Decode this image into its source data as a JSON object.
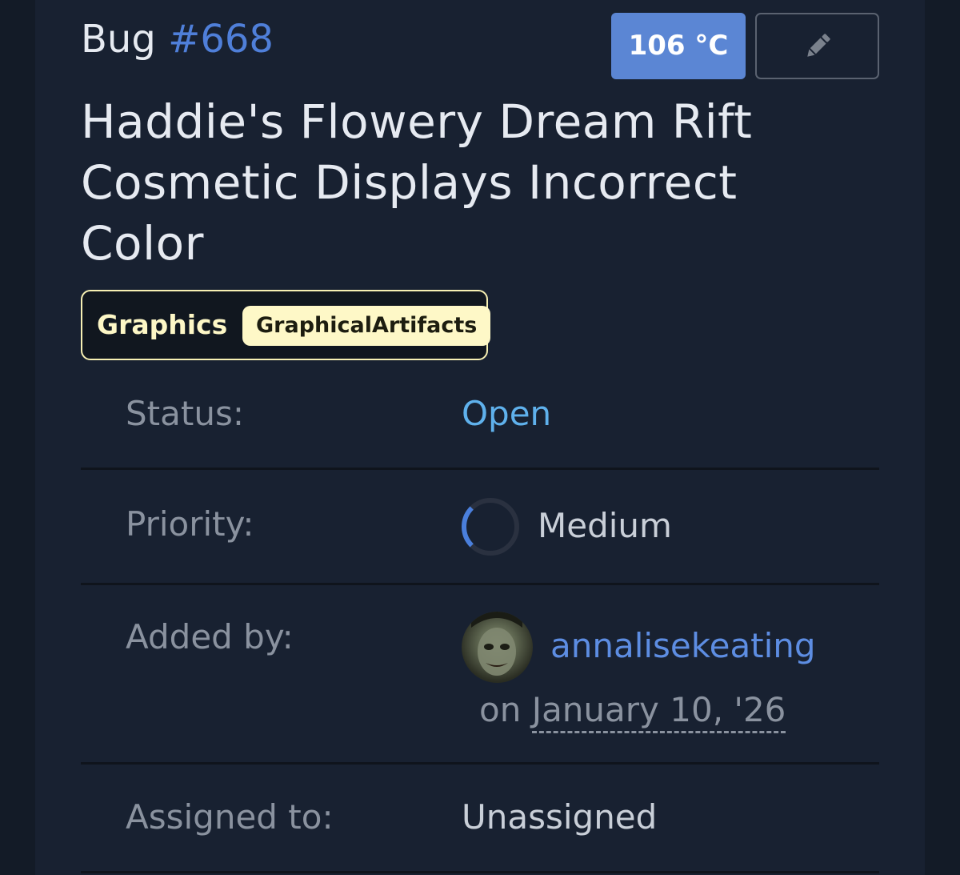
{
  "header": {
    "bug_prefix": "Bug",
    "bug_number": "#668",
    "temperature": "106 °C",
    "edit_icon": "pencil-icon"
  },
  "title": "Haddie's Flowery Dream Rift Cosmetic Displays Incorrect Color",
  "tags": {
    "category": "Graphics",
    "subcategory": "GraphicalArtifacts"
  },
  "details": {
    "status_label": "Status:",
    "status_value": "Open",
    "priority_label": "Priority:",
    "priority_value": "Medium",
    "priority_level": 0.25,
    "added_by_label": "Added by:",
    "reporter": "annalisekeating",
    "date_prefix": "on",
    "date_value": "January 10, '26",
    "assigned_to_label": "Assigned to:",
    "assignee": "Unassigned"
  },
  "colors": {
    "accent": "#4f7fd9",
    "status_open": "#5fb1ec",
    "category_chip": "#fef8c7",
    "background": "#182131"
  }
}
